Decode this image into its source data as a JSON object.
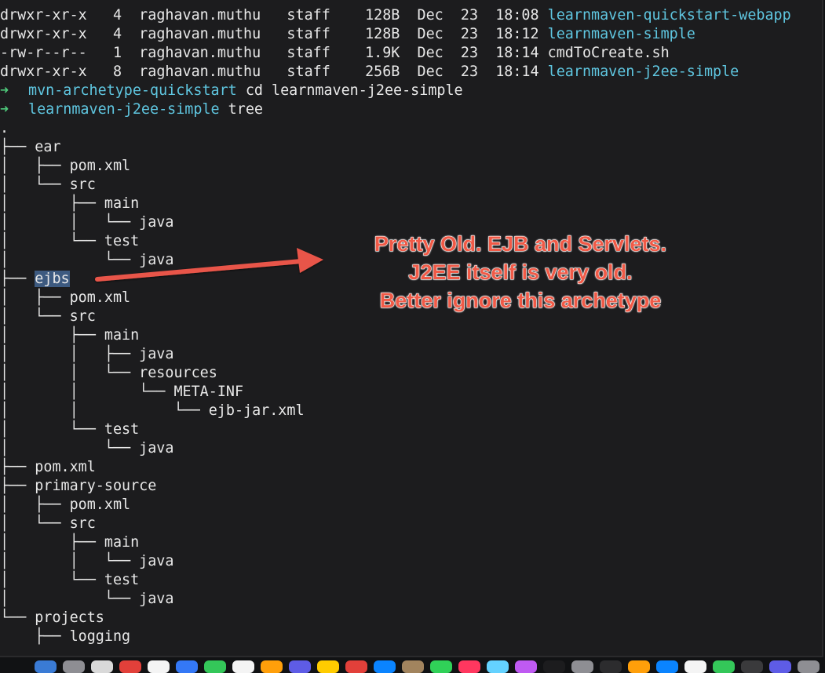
{
  "terminal": {
    "listing": [
      {
        "perms": "drwxr-xr-x",
        "links": "4",
        "owner": "raghavan.muthu",
        "group": "staff",
        "size": "128B",
        "month": "Dec",
        "day": "23",
        "time": "18:08",
        "name": "learnmaven-quickstart-webapp",
        "is_dir": true
      },
      {
        "perms": "drwxr-xr-x",
        "links": "4",
        "owner": "raghavan.muthu",
        "group": "staff",
        "size": "128B",
        "month": "Dec",
        "day": "23",
        "time": "18:12",
        "name": "learnmaven-simple",
        "is_dir": true
      },
      {
        "perms": "-rw-r--r--",
        "links": "1",
        "owner": "raghavan.muthu",
        "group": "staff",
        "size": "1.9K",
        "month": "Dec",
        "day": "23",
        "time": "18:14",
        "name": "cmdToCreate.sh",
        "is_dir": false
      },
      {
        "perms": "drwxr-xr-x",
        "links": "8",
        "owner": "raghavan.muthu",
        "group": "staff",
        "size": "256B",
        "month": "Dec",
        "day": "23",
        "time": "18:14",
        "name": "learnmaven-j2ee-simple",
        "is_dir": true
      }
    ],
    "prompts": [
      {
        "arrow": "➜",
        "dir": "mvn-archetype-quickstart",
        "command": "cd learnmaven-j2ee-simple"
      },
      {
        "arrow": "➜",
        "dir": "learnmaven-j2ee-simple",
        "command": "tree"
      }
    ],
    "tree": [
      {
        "prefix": "",
        "name": "."
      },
      {
        "prefix": "├── ",
        "name": "ear"
      },
      {
        "prefix": "│   ├── ",
        "name": "pom.xml"
      },
      {
        "prefix": "│   └── ",
        "name": "src"
      },
      {
        "prefix": "│       ├── ",
        "name": "main"
      },
      {
        "prefix": "│       │   └── ",
        "name": "java"
      },
      {
        "prefix": "│       └── ",
        "name": "test"
      },
      {
        "prefix": "│           └── ",
        "name": "java"
      },
      {
        "prefix": "├── ",
        "name": "ejbs",
        "selected": true
      },
      {
        "prefix": "│   ├── ",
        "name": "pom.xml"
      },
      {
        "prefix": "│   └── ",
        "name": "src"
      },
      {
        "prefix": "│       ├── ",
        "name": "main"
      },
      {
        "prefix": "│       │   ├── ",
        "name": "java"
      },
      {
        "prefix": "│       │   └── ",
        "name": "resources"
      },
      {
        "prefix": "│       │       └── ",
        "name": "META-INF"
      },
      {
        "prefix": "│       │           └── ",
        "name": "ejb-jar.xml"
      },
      {
        "prefix": "│       └── ",
        "name": "test"
      },
      {
        "prefix": "│           └── ",
        "name": "java"
      },
      {
        "prefix": "├── ",
        "name": "pom.xml"
      },
      {
        "prefix": "├── ",
        "name": "primary-source"
      },
      {
        "prefix": "│   ├── ",
        "name": "pom.xml"
      },
      {
        "prefix": "│   └── ",
        "name": "src"
      },
      {
        "prefix": "│       ├── ",
        "name": "main"
      },
      {
        "prefix": "│       │   └── ",
        "name": "java"
      },
      {
        "prefix": "│       └── ",
        "name": "test"
      },
      {
        "prefix": "│           └── ",
        "name": "java"
      },
      {
        "prefix": "└── ",
        "name": "projects"
      },
      {
        "prefix": "    ├── ",
        "name": "logging"
      }
    ]
  },
  "annotation": {
    "lines": [
      "Pretty Old. EJB and Servlets.",
      "J2EE itself is very old.",
      "Better ignore this archetype"
    ],
    "text_color": "#f05a47",
    "arrow_color": "#e8554a"
  },
  "colors": {
    "background": "#1c1c1e",
    "text": "#e8e8e8",
    "directory": "#5fc6e0",
    "prompt": "#4ec97b",
    "selection": "#3d5a80"
  }
}
